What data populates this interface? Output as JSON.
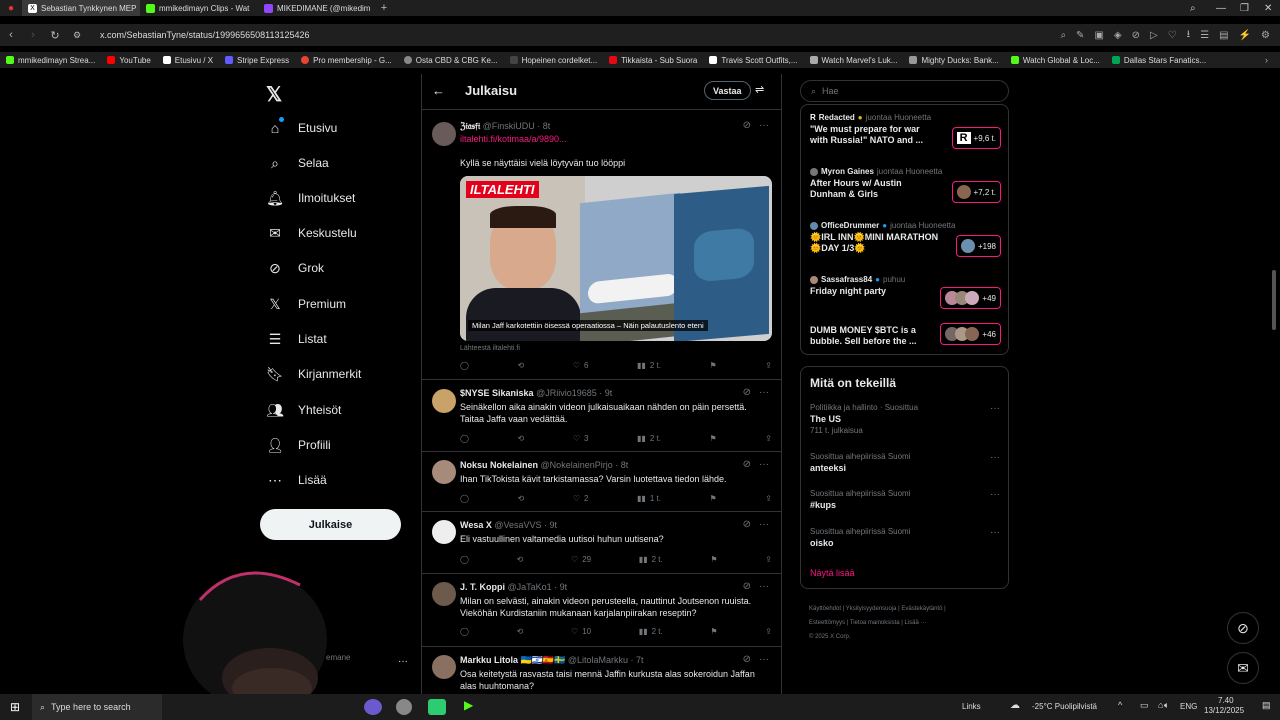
{
  "browser": {
    "tabs": [
      {
        "label": "Sebastian Tynkkynen MEP",
        "active": true,
        "fav": "#222"
      },
      {
        "label": "mmikedimayn Clips - Wat",
        "active": false,
        "fav": "#53fc18"
      },
      {
        "label": "MIKEDIMANE (@mikedim",
        "active": false,
        "fav": "#9146ff"
      }
    ],
    "url": "x.com/SebastianTyne/status/1999656508113125426",
    "bookmarks": [
      {
        "label": "mmikedimayn Strea...",
        "color": "#53fc18"
      },
      {
        "label": "YouTube",
        "color": "#ff0000"
      },
      {
        "label": "Etusivu / X",
        "color": "#ffffff"
      },
      {
        "label": "Stripe Express",
        "color": "#635bff"
      },
      {
        "label": "Pro membership - G...",
        "color": "#ea4335"
      },
      {
        "label": "Osta CBD & CBG Ke...",
        "color": "#888"
      },
      {
        "label": "Hopeinen cordelket...",
        "color": "#444"
      },
      {
        "label": "Tikkaista - Sub Suora",
        "color": "#e50914"
      },
      {
        "label": "Travis Scott Outfits,...",
        "color": "#fff"
      },
      {
        "label": "Watch Marvel's Luk...",
        "color": "#aaa"
      },
      {
        "label": "Mighty Ducks: Bank...",
        "color": "#999"
      },
      {
        "label": "Watch Global & Loc...",
        "color": "#53fc18"
      },
      {
        "label": "Dallas Stars Fanatics...",
        "color": "#00a651"
      }
    ]
  },
  "leftnav": {
    "items": [
      {
        "label": "Etusivu",
        "icon": "home-icon"
      },
      {
        "label": "Selaa",
        "icon": "search-icon"
      },
      {
        "label": "Ilmoitukset",
        "icon": "bell-icon"
      },
      {
        "label": "Keskustelu",
        "icon": "mail-icon"
      },
      {
        "label": "Grok",
        "icon": "grok-icon"
      },
      {
        "label": "Premium",
        "icon": "x-icon"
      },
      {
        "label": "Listat",
        "icon": "list-icon"
      },
      {
        "label": "Kirjanmerkit",
        "icon": "bookmark-icon"
      },
      {
        "label": "Yhteisöt",
        "icon": "community-icon"
      },
      {
        "label": "Profiili",
        "icon": "user-icon"
      },
      {
        "label": "Lisää",
        "icon": "more-icon"
      }
    ],
    "post_button": "Julkaise",
    "account_handle": "emane"
  },
  "main": {
    "title": "Julkaisu",
    "reply_button": "Vastaa",
    "posts": [
      {
        "name": "ℨ𝔦𝔞𝔰𝔣𝔦",
        "handle": "@FinskiUDU · 8t",
        "link": "iltalehti.fi/kotimaa/a/9890...",
        "text": "Kyllä se näyttäisi vielä löytyvän tuo lööppi",
        "image_caption": "Milan Jaff karkotettiin öisessä operaatiossa – Näin palautuslento eteni",
        "image_brand": "ILTALEHTI",
        "source": "Lähteestä iltalehti.fi",
        "likes": "6",
        "views": "2 t."
      },
      {
        "name": "$NYSE Sikaniska",
        "handle": "@JRiivio19685 · 9t",
        "text": "Seinäkellon aika ainakin videon julkaisuaikaan nähden on päin persettä. Taitaa Jaffa vaan vedättää.",
        "likes": "3",
        "views": "2 t."
      },
      {
        "name": "Noksu Nokelainen",
        "handle": "@NokelainenPirjo · 8t",
        "text": "Ihan TikTokista kävit tarkistamassa? Varsin luotettava tiedon lähde.",
        "likes": "2",
        "views": "1 t."
      },
      {
        "name": "Wesa X",
        "handle": "@VesaVVS · 9t",
        "text": "Eli vastuullinen valtamedia uutisoi huhun uutisena?",
        "likes": "29",
        "views": "2 t."
      },
      {
        "name": "J. T. Koppi",
        "handle": "@JaTaKo1 · 9t",
        "text": "Milan on selvästi, ainakin videon perusteella, nauttinut Joutsenon ruuista. Vieköhän Kurdistaniin mukanaan karjalanpiirakan reseptin?",
        "likes": "10",
        "views": "2 t."
      },
      {
        "name": "Markku Litola 🇺🇦🇮🇱🇪🇸🇸🇪",
        "handle": "@LitolaMarkku · 7t",
        "text": "Osa keitetystä rasvasta taisi mennä Jaffin kurkusta alas sokeroidun Jaffan alas huuhtomana?",
        "likes": "",
        "views": ""
      }
    ]
  },
  "right": {
    "search_placeholder": "Hae",
    "live": [
      {
        "host": "Redacted",
        "role": "juontaa Huoneetta",
        "title": "\"We must prepare for war with Russia!\" NATO and ...",
        "count": "+9,6 t."
      },
      {
        "host": "Myron Gaines",
        "role": "juontaa Huoneetta",
        "title": "After Hours w/ Austin Dunham & Girls",
        "count": "+7,2 t."
      },
      {
        "host": "OfficeDrummer",
        "role": "juontaa Huoneetta",
        "title": "🌞IRL INN🌞MINI MARATHON🌞DAY 1/3🌞",
        "count": "+198"
      },
      {
        "host": "Sassafrass84",
        "role": "puhuu",
        "title": "Friday night party",
        "count": "+49"
      },
      {
        "host": "",
        "role": "",
        "title": "DUMB MONEY $BTC is a bubble. Sell before the ...",
        "count": "+46"
      }
    ],
    "trends_title": "Mitä on tekeillä",
    "trends": [
      {
        "context": "Politiikka ja hallinto · Suosittua",
        "name": "The US",
        "count": "711 t. julkaisua"
      },
      {
        "context": "Suosittua aihepiirissä Suomi",
        "name": "anteeksi",
        "count": ""
      },
      {
        "context": "Suosittua aihepiirissä Suomi",
        "name": "#kups",
        "count": ""
      },
      {
        "context": "Suosittua aihepiirissä Suomi",
        "name": "oisko",
        "count": ""
      }
    ],
    "show_more": "Näytä lisää",
    "footer_line1": "Käyttöehdot | Yksityisyydensuoja | Evästekäytäntö |",
    "footer_line2": "Esteettömyys | Tietoa mainoksista | Lisää ···",
    "footer_line3": "© 2025 X Corp."
  },
  "taskbar": {
    "search_placeholder": "Type here to search",
    "links": "Links",
    "weather": "-25°C Puolipilvistä",
    "lang": "ENG",
    "time": "7.40",
    "date": "13/12/2025"
  }
}
